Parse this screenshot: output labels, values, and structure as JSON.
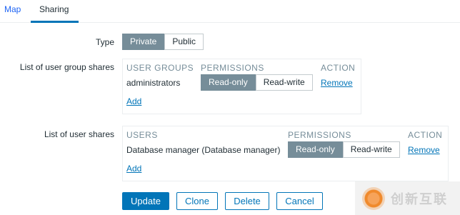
{
  "tabs": [
    {
      "label": "Map"
    },
    {
      "label": "Sharing"
    }
  ],
  "form": {
    "type_label": "Type",
    "type_options": [
      "Private",
      "Public"
    ],
    "type_selected": "Private",
    "group_shares_label": "List of user group shares",
    "user_shares_label": "List of user shares"
  },
  "group_shares": {
    "headers": {
      "group": "USER GROUPS",
      "permissions": "PERMISSIONS",
      "action": "ACTION"
    },
    "rows": [
      {
        "name": "administrators",
        "perm_options": [
          "Read-only",
          "Read-write"
        ],
        "perm_selected": "Read-only",
        "action": "Remove"
      }
    ],
    "add_label": "Add"
  },
  "user_shares": {
    "headers": {
      "user": "USERS",
      "permissions": "PERMISSIONS",
      "action": "ACTION"
    },
    "rows": [
      {
        "name": "Database manager (Database manager)",
        "perm_options": [
          "Read-only",
          "Read-write"
        ],
        "perm_selected": "Read-only",
        "action": "Remove"
      }
    ],
    "add_label": "Add"
  },
  "buttons": {
    "update": "Update",
    "clone": "Clone",
    "delete": "Delete",
    "cancel": "Cancel"
  },
  "watermark": {
    "text": "创新互联",
    "icon": "brand-logo-icon"
  },
  "colors": {
    "accent": "#0275b8",
    "active_segment": "#768d99",
    "link": "#0275b8"
  }
}
